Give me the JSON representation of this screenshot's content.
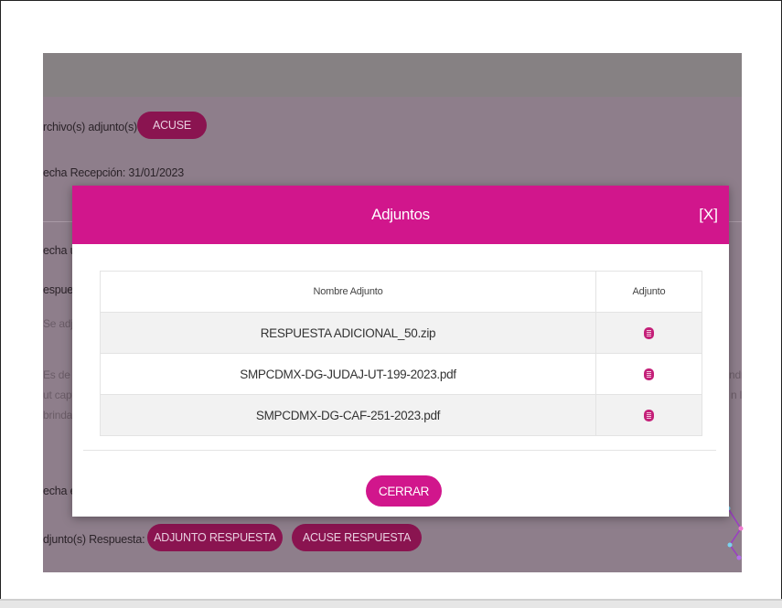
{
  "background": {
    "attachments_label": "rchivo(s) adjunto(s):",
    "acuse_button": "ACUSE",
    "reception_date_label": "echa Recepción: 31/01/2023",
    "partial_labels": [
      "echa úl",
      "espues",
      "Se adju",
      "Es de s",
      "ut capt",
      "brinda",
      "echa er"
    ],
    "right_fragments": [
      "ndrá",
      "n la"
    ],
    "response_attachments_label": "djunto(s) Respuesta:",
    "adjunto_respuesta_button": "ADJUNTO RESPUESTA",
    "acuse_respuesta_button": "ACUSE RESPUESTA"
  },
  "modal": {
    "title": "Adjuntos",
    "close_label": "[X]",
    "columns": [
      "Nombre Adjunto",
      "Adjunto"
    ],
    "rows": [
      {
        "name": "RESPUESTA ADICIONAL_50.zip",
        "icon": "file-download-icon"
      },
      {
        "name": "SMPCDMX-DG-JUDAJ-UT-199-2023.pdf",
        "icon": "file-download-icon"
      },
      {
        "name": "SMPCDMX-DG-CAF-251-2023.pdf",
        "icon": "file-download-icon"
      }
    ],
    "close_button": "CERRAR"
  },
  "colors": {
    "accent": "#d1168c",
    "overlay_button": "#8a1450",
    "overlay": "#8e7e8b"
  }
}
